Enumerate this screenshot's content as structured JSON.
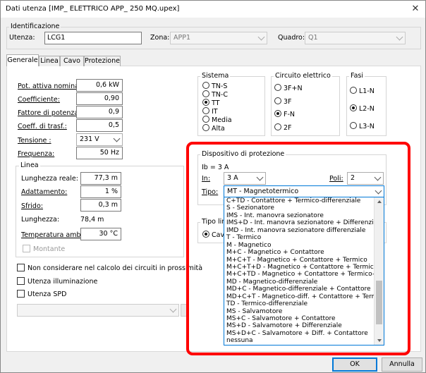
{
  "window": {
    "title": "Dati utenza [IMP_ ELETTRICO APP_ 250 MQ.upex]",
    "close_glyph": "✕"
  },
  "ident": {
    "group_label": "Identificazione",
    "utenza_label": "Utenza:",
    "utenza_value": "LCG1",
    "zona_label": "Zona:",
    "zona_value": "APP1",
    "quadro_label": "Quadro:",
    "quadro_value": "Q1"
  },
  "tabs": [
    "Generale",
    "Linea",
    "Cavo",
    "Protezione"
  ],
  "fields": [
    {
      "label": "Pot. attiva nominale:",
      "value": "0,6 kW"
    },
    {
      "label": "Coefficiente:",
      "value": "0,90"
    },
    {
      "label": "Fattore di potenza:",
      "value": "0,9"
    },
    {
      "label": "Coeff. di trasf.:",
      "value": "0,5"
    },
    {
      "label": "Tensione :",
      "value": "231 V"
    },
    {
      "label": "Frequenza:",
      "value": "50 Hz"
    }
  ],
  "linea": {
    "group_label": "Linea",
    "lunghezza_reale_label": "Lunghezza reale:",
    "lunghezza_reale_value": "77,3 m",
    "adattamento_label": "Adattamento:",
    "adattamento_value": "1 %",
    "sfrido_label": "Sfrido:",
    "sfrido_value": "0,3 m",
    "lunghezza_label": "Lunghezza:",
    "lunghezza_value": "78,4 m",
    "temperatura_label": "Temperatura amb.",
    "temperatura_value": "30 °C",
    "montante_label": "Montante"
  },
  "checks": {
    "prossimita": "Non considerare nel calcolo dei circuiti in prossimità",
    "illuminazione": "Utenza illuminazione",
    "spd": "Utenza SPD"
  },
  "sistema": {
    "label": "Sistema",
    "options": [
      "TN-S",
      "TN-C",
      "TT",
      "IT",
      "Media",
      "Alta"
    ],
    "selected": "TT"
  },
  "circuito": {
    "label": "Circuito elettrico",
    "options": [
      "3F+N",
      "3F",
      "F-N",
      "2F"
    ],
    "selected": "F-N"
  },
  "fasi": {
    "label": "Fasi",
    "options": [
      "L1-N",
      "L2-N",
      "L3-N"
    ],
    "selected": "L2-N"
  },
  "dispositivo": {
    "label": "Dispositivo di protezione",
    "ib": "Ib = 3 A",
    "in_label": "In:",
    "in_value": "3 A",
    "poli_label": "Poli:",
    "poli_value": "2",
    "tipo_label": "Tipo:",
    "tipo_value": "MT - Magnetotermico"
  },
  "tipo_linea": {
    "label": "Tipo linea",
    "option": "Cavo"
  },
  "dropdown_items": [
    "C+TD - Contattore + Termico-differenziale",
    "S - Sezionatore",
    "IMS - Int. manovra sezionatore",
    "IMS+D - Int. manovra sezionatore + Differenziale",
    "IMD - Int. manovra sezionatore differenziale",
    "T - Termico",
    "M - Magnetico",
    "M+C - Magnetico + Contattore",
    "M+C+T - Magnetico + Contattore + Termico",
    "M+C+T+D - Magnetico + Contattore + Termico + Diff",
    "M+C+TD - Magnetico + Contattore + Termico-diff.",
    "MD - Magnetico-differenziale",
    "MD+C - Magnetico-differenziale + Contattore",
    "MD+C+T - Magnetico-diff. + Contattore + Termico",
    "TD - Termico-differenziale",
    "MS - Salvamotore",
    "MS+C - Salvamotore + Contattore",
    "MS+D - Salvamotore + Differenziale",
    "MS+D+C - Salvamotore + Diff. + Contattore",
    "nessuna"
  ],
  "buttons": {
    "ok": "OK",
    "annulla": "Annulla"
  }
}
